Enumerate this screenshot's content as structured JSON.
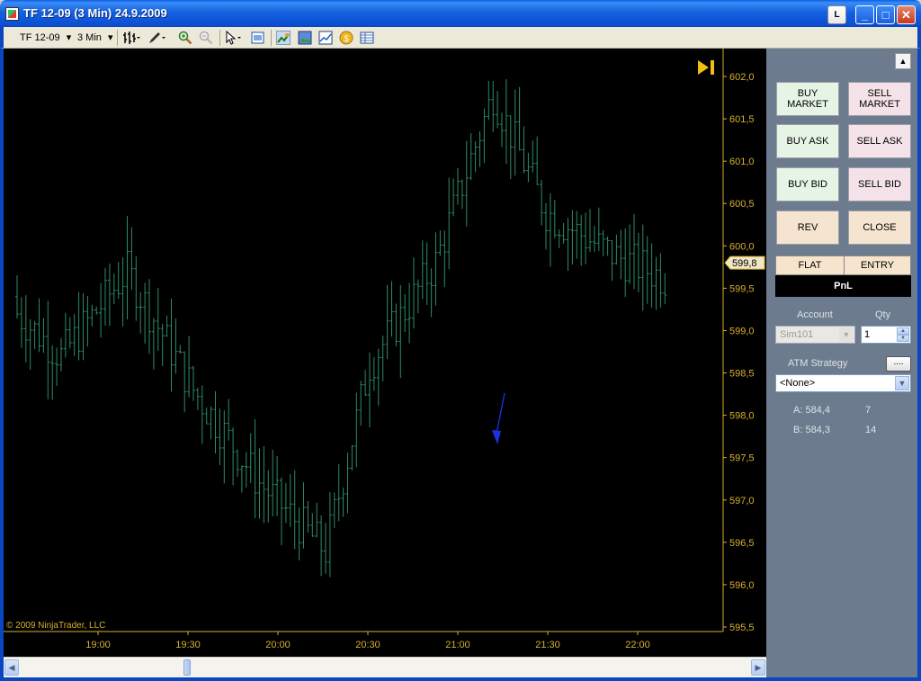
{
  "window": {
    "title": "TF 12-09 (3 Min)  24.9.2009",
    "l_button": "L",
    "minimize": "_",
    "maximize": "□",
    "close": "✕"
  },
  "toolbar": {
    "instrument": "TF 12-09",
    "interval": "3 Min",
    "dropdown": "▾"
  },
  "chart_data": {
    "type": "bar",
    "style": "OHLC",
    "x_ticks": [
      "19:00",
      "19:30",
      "20:00",
      "20:30",
      "21:00",
      "21:30",
      "22:00"
    ],
    "y_ticks": [
      "602,0",
      "601,5",
      "601,0",
      "600,5",
      "600,0",
      "599,5",
      "599,0",
      "598,5",
      "598,0",
      "597,5",
      "597,0",
      "596,5",
      "596,0",
      "595,5"
    ],
    "ylim": [
      595.5,
      602.0
    ],
    "last_price": "599,8",
    "bar_color": "#2e8b64",
    "axis_color": "#d6b030",
    "background": "#000000",
    "copyright": "© 2009 NinjaTrader, LLC"
  },
  "panel": {
    "collapse_icon": "▲",
    "buy_market": "BUY\nMARKET",
    "sell_market": "SELL\nMARKET",
    "buy_ask": "BUY ASK",
    "sell_ask": "SELL ASK",
    "buy_bid": "BUY BID",
    "sell_bid": "SELL BID",
    "rev": "REV",
    "close": "CLOSE",
    "position": "FLAT",
    "entry": "ENTRY",
    "pnl": "PnL",
    "account_label": "Account",
    "qty_label": "Qty",
    "account_value": "Sim101",
    "qty_value": "1",
    "atm_label": "ATM Strategy",
    "atm_button": "....",
    "atm_value": "<None>",
    "ask_label": "A: 584,4",
    "ask_size": "7",
    "bid_label": "B: 584,3",
    "bid_size": "14"
  }
}
